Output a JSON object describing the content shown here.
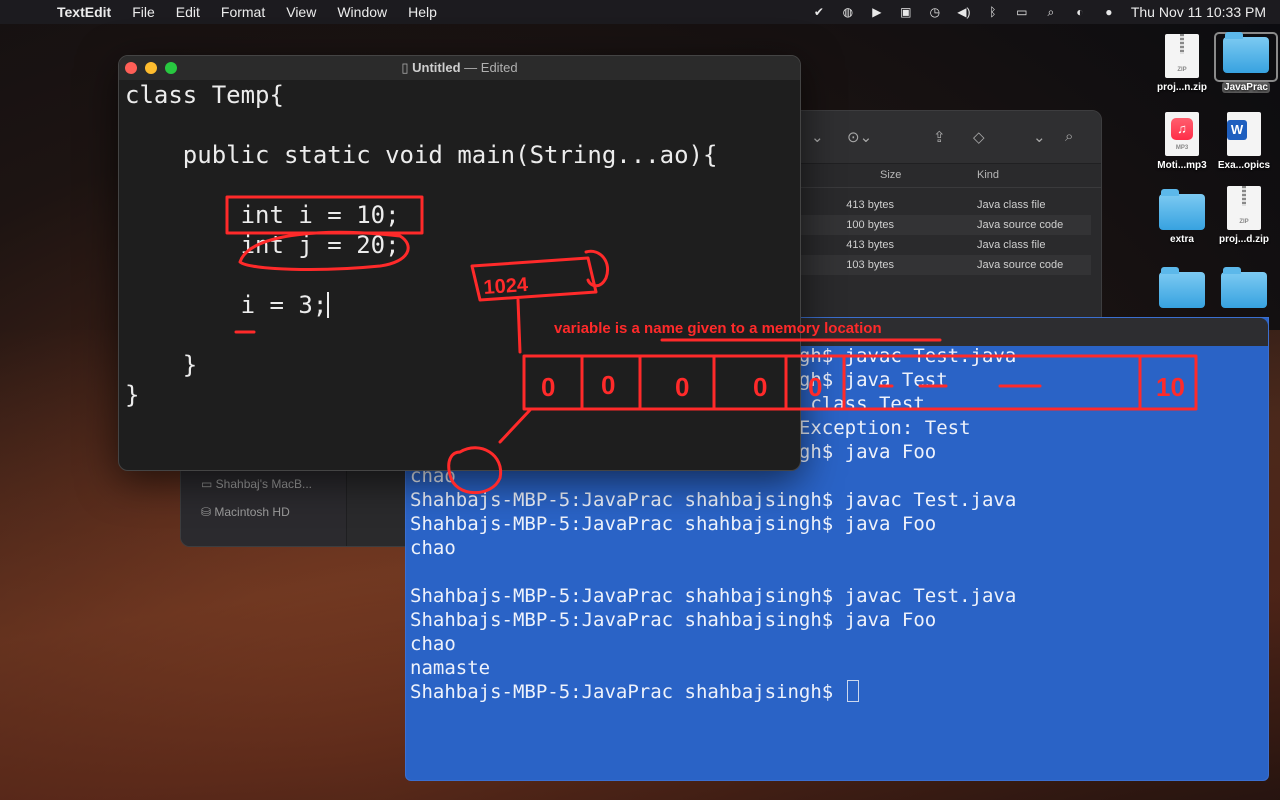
{
  "menubar": {
    "app": "TextEdit",
    "items": [
      "File",
      "Edit",
      "Format",
      "View",
      "Window",
      "Help"
    ],
    "clock": "Thu Nov 11  10:33 PM"
  },
  "desktop": {
    "icons": [
      {
        "label": "proj...n.zip",
        "type": "zip"
      },
      {
        "label": "JavaPrac",
        "type": "folder"
      },
      {
        "label": "Moti...mp3",
        "type": "mp3"
      },
      {
        "label": "Exa...opics",
        "type": "word"
      },
      {
        "label": "extra",
        "type": "folder"
      },
      {
        "label": "proj...d.zip",
        "type": "zip"
      }
    ],
    "zip_tag": "ZIP",
    "mp3_tag": "MP3"
  },
  "textedit": {
    "title": "Untitled",
    "status": "— Edited",
    "lines": [
      "class Temp{",
      "",
      "    public static void main(String...ao){",
      "",
      "        int i = 10;",
      "        int j = 20;",
      "",
      "        i = 3;",
      "",
      "    }",
      "}"
    ]
  },
  "finder": {
    "columns": {
      "size": "Size",
      "kind": "Kind"
    },
    "rows": [
      {
        "size": "413 bytes",
        "kind": "Java class file"
      },
      {
        "size": "100 bytes",
        "kind": "Java source code"
      },
      {
        "size": "413 bytes",
        "kind": "Java class file"
      },
      {
        "size": "103 bytes",
        "kind": "Java source code"
      }
    ],
    "sidebar": [
      "Shahbaj's MacB...",
      "Macintosh HD"
    ]
  },
  "terminal": {
    "lines": [
      "Shahbajs-MBP-5:JavaPrac shahbajsingh$ javac Test.java",
      "Shahbajs-MBP-5:JavaPrac shahbajsingh$ java Test",
      "Error: Could not find or load main class Test",
      "Caused by: java.lang.ClassNotFoundException: Test",
      "Shahbajs-MBP-5:JavaPrac shahbajsingh$ java Foo",
      "chao",
      "Shahbajs-MBP-5:JavaPrac shahbajsingh$ javac Test.java",
      "Shahbajs-MBP-5:JavaPrac shahbajsingh$ java Foo",
      "chao",
      "",
      "Shahbajs-MBP-5:JavaPrac shahbajsingh$ javac Test.java",
      "Shahbajs-MBP-5:JavaPrac shahbajsingh$ java Foo",
      "chao",
      "namaste",
      "Shahbajs-MBP-5:JavaPrac shahbajsingh$ "
    ]
  },
  "annotation": {
    "text": "variable is a name given to a memory location",
    "address": "1024",
    "cells": [
      "0",
      "0",
      "0",
      "0",
      "0"
    ],
    "value": "10",
    "color": "#ff2a2a"
  }
}
